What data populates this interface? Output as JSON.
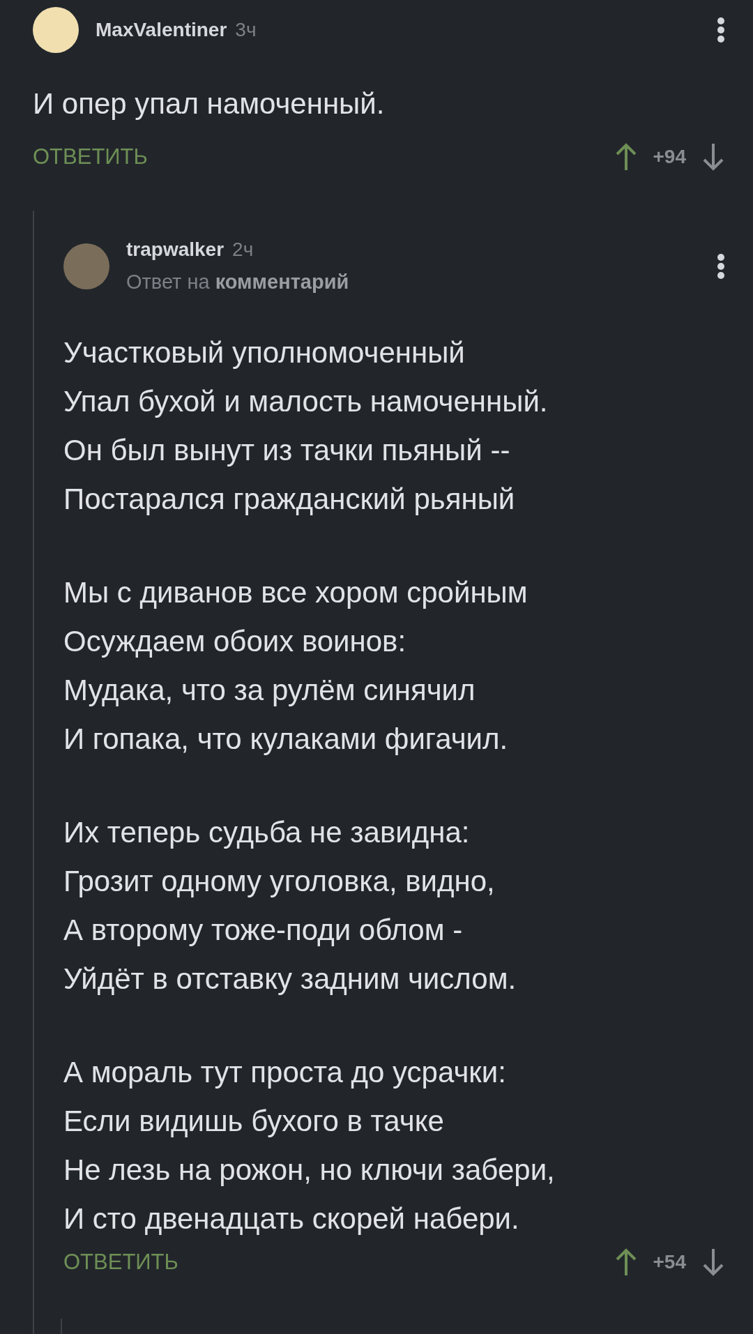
{
  "comment": {
    "author": "MaxValentiner",
    "time": "3ч",
    "text": "И опер упал намоченный.",
    "reply_label": "ОТВЕТИТЬ",
    "rating": "+94",
    "upvoted": true,
    "replies": [
      {
        "author": "trapwalker",
        "time": "2ч",
        "reply_to_prefix": "Ответ на",
        "reply_to_link": "комментарий",
        "reply_label": "ОТВЕТИТЬ",
        "rating": "+54",
        "upvoted": true,
        "stanzas": [
          [
            "Участковый уполномоченный",
            "Упал бухой и малость намоченный.",
            "Он был вынут из тачки пьяный --",
            "Постарался гражданский рьяный"
          ],
          [
            "Мы с диванов все хором сройным",
            "Осуждаем обоих воинов:",
            "Мудака, что за рулём синячил",
            "И гопака, что кулаками фигачил."
          ],
          [
            "Их теперь судьба не завидна:",
            "Грозит одному уголовка, видно,",
            "А второму тоже-поди облом -",
            "Уйдёт в отставку задним числом."
          ],
          [
            "А мораль тут проста до усрачки:",
            "Если видишь бухого в тачке",
            "Не лезь на рожон, но ключи забери,",
            "И сто двенадцать скорей набери."
          ]
        ]
      }
    ]
  }
}
